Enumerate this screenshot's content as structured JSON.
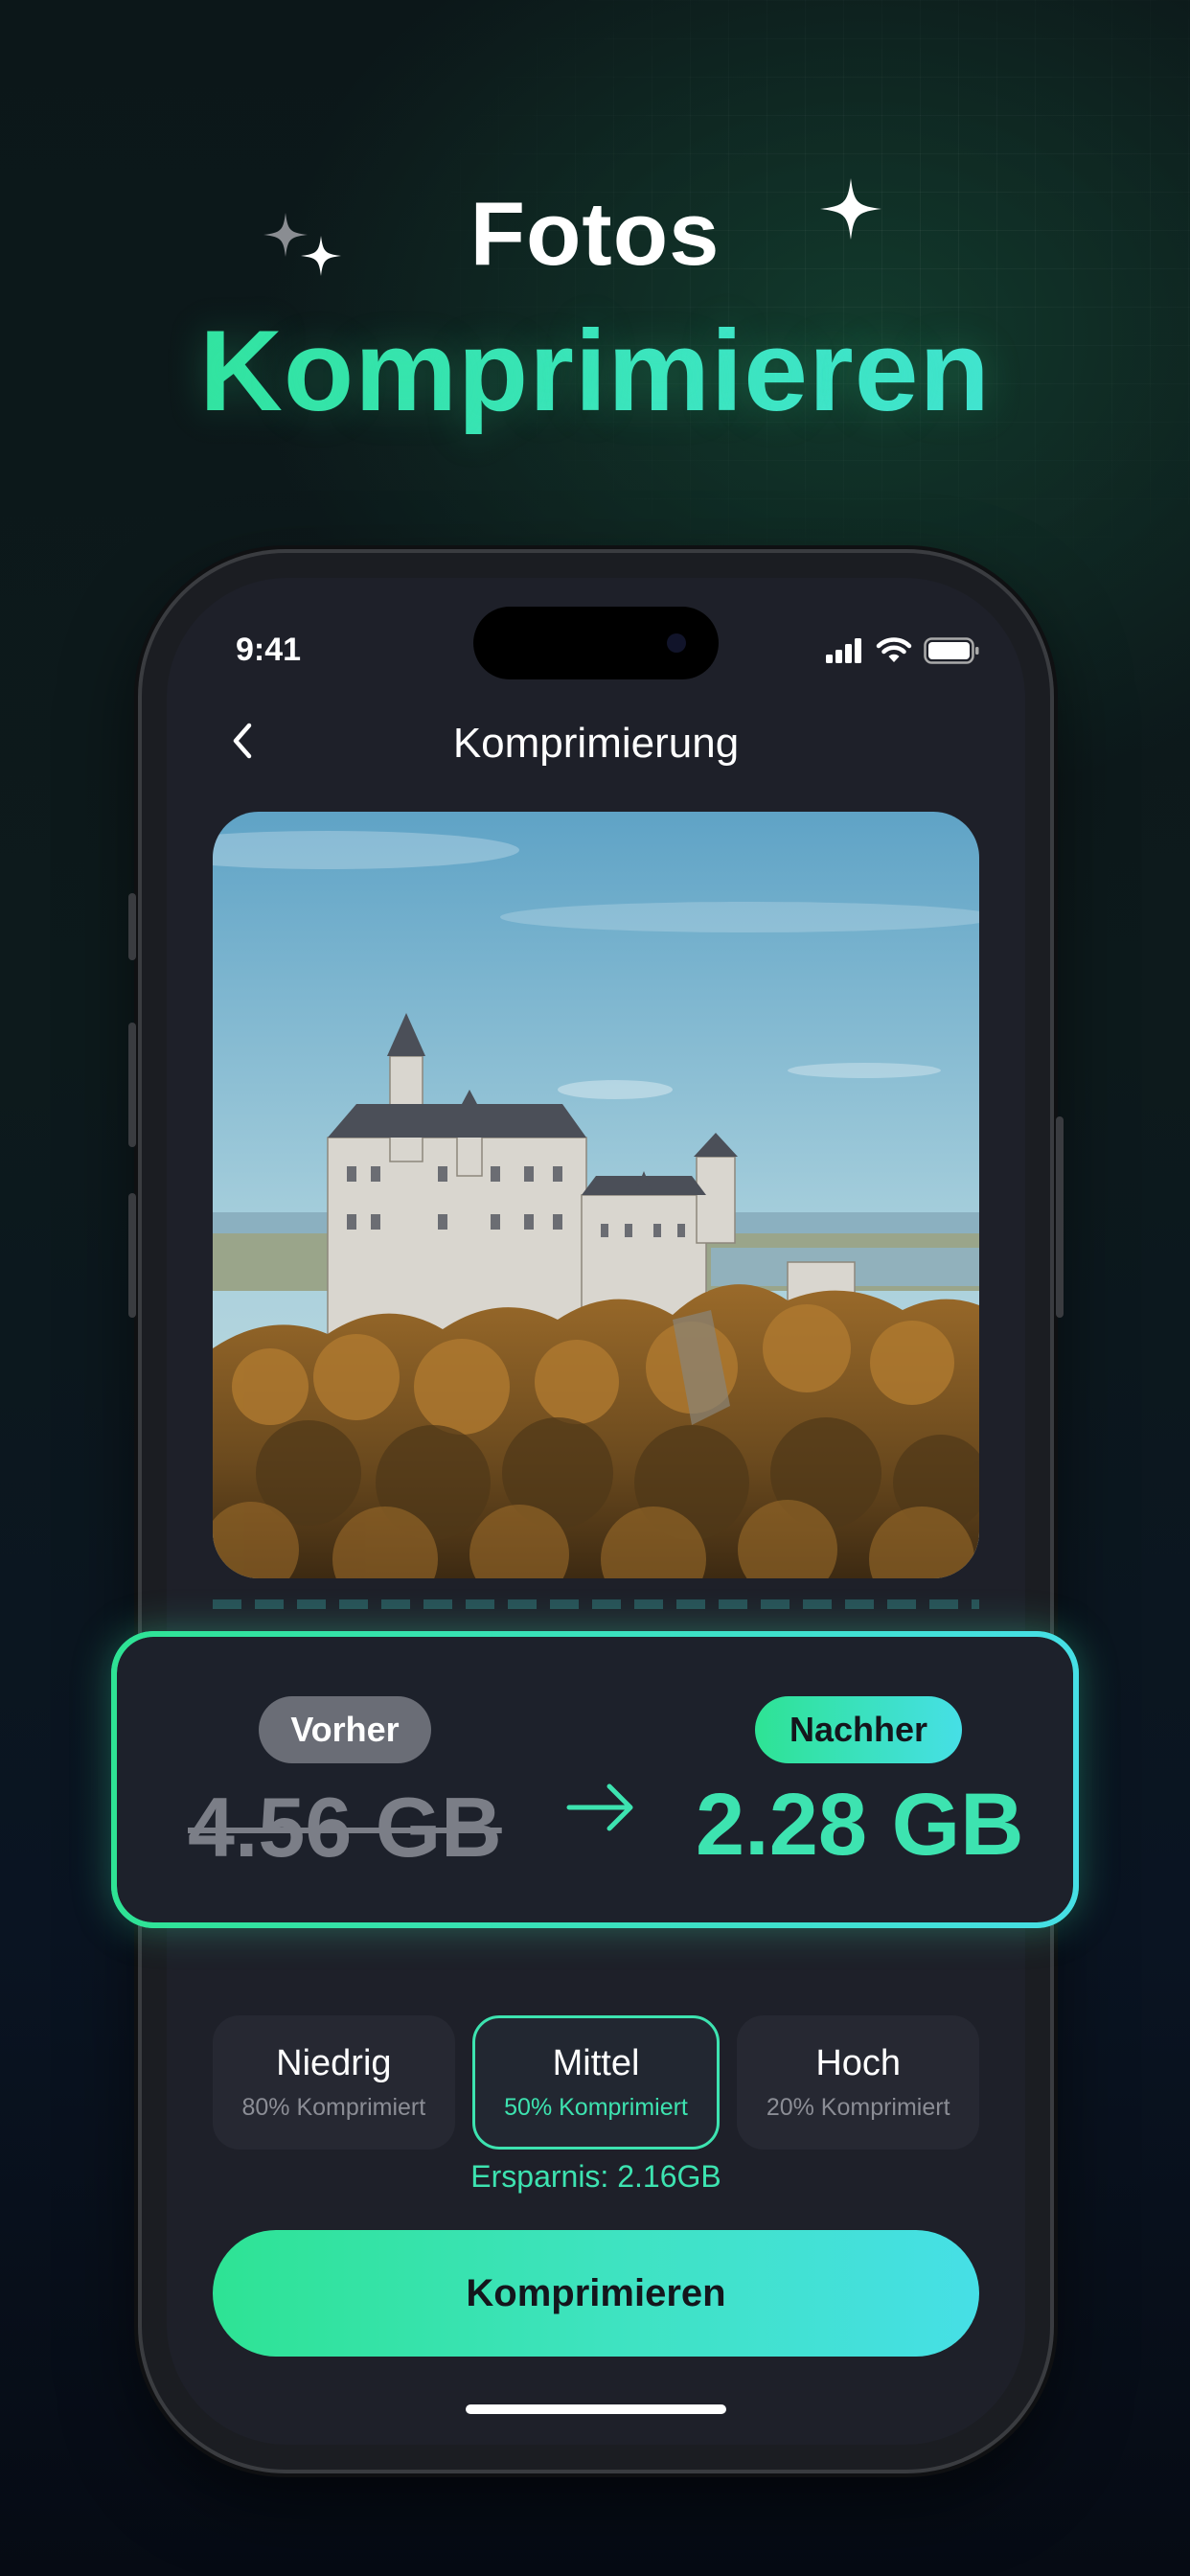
{
  "headline": {
    "line1": "Fotos",
    "line2": "Komprimieren"
  },
  "status_bar": {
    "time": "9:41"
  },
  "nav": {
    "title": "Komprimierung",
    "back_icon": "chevron-left-icon"
  },
  "comparison": {
    "before_label": "Vorher",
    "before_size": "4.56 GB",
    "after_label": "Nachher",
    "after_size": "2.28 GB",
    "arrow_icon": "arrow-right-icon"
  },
  "options": [
    {
      "title": "Niedrig",
      "subtitle": "80% Komprimiert",
      "selected": false
    },
    {
      "title": "Mittel",
      "subtitle": "50% Komprimiert",
      "selected": true
    },
    {
      "title": "Hoch",
      "subtitle": "20% Komprimiert",
      "selected": false
    }
  ],
  "savings_text": "Ersparnis: 2.16GB",
  "cta_label": "Komprimieren",
  "colors": {
    "accent_green": "#2ee394",
    "accent_cyan": "#46dfe6",
    "screen_bg": "#1e2029"
  }
}
